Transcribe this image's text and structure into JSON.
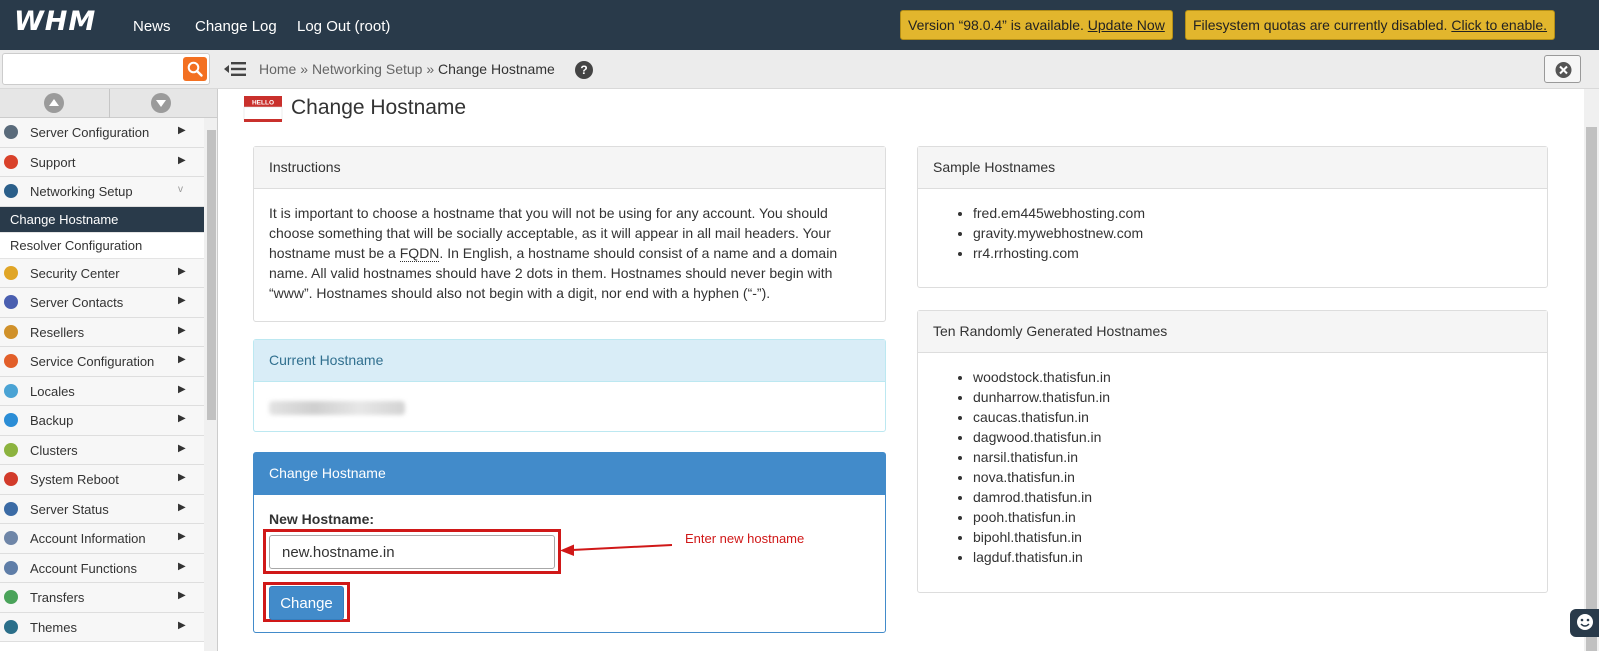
{
  "app": {
    "logo": "WHM"
  },
  "topnav": {
    "news": "News",
    "changelog": "Change Log",
    "logout": "Log Out (root)"
  },
  "notices": {
    "version": {
      "text": "Version “98.0.4” is available. ",
      "link": "Update Now"
    },
    "quota": {
      "text": "Filesystem quotas are currently disabled. ",
      "link": "Click to enable."
    }
  },
  "search": {
    "value": ""
  },
  "breadcrumb": {
    "home": "Home",
    "section": "Networking Setup",
    "current": "Change Hostname",
    "sep": "»"
  },
  "sidebar": {
    "items_before": [
      {
        "label": "Server Configuration",
        "arrow": "▶",
        "icon_color": "#5a6b7b"
      },
      {
        "label": "Support",
        "arrow": "▶",
        "icon_color": "#d9422b"
      },
      {
        "label": "Networking Setup",
        "arrow": "v",
        "icon_color": "#2b5f8a"
      }
    ],
    "sub_items": [
      {
        "label": "Change Hostname"
      },
      {
        "label": "Resolver Configuration"
      }
    ],
    "items_after": [
      {
        "label": "Security Center",
        "arrow": "▶",
        "icon_color": "#e0a526"
      },
      {
        "label": "Server Contacts",
        "arrow": "▶",
        "icon_color": "#4a5fb0"
      },
      {
        "label": "Resellers",
        "arrow": "▶",
        "icon_color": "#d0912a"
      },
      {
        "label": "Service Configuration",
        "arrow": "▶",
        "icon_color": "#e25f2a"
      },
      {
        "label": "Locales",
        "arrow": "▶",
        "icon_color": "#4aa3d4"
      },
      {
        "label": "Backup",
        "arrow": "▶",
        "icon_color": "#2b8dd6"
      },
      {
        "label": "Clusters",
        "arrow": "▶",
        "icon_color": "#8cb33f"
      },
      {
        "label": "System Reboot",
        "arrow": "▶",
        "icon_color": "#d23b2b"
      },
      {
        "label": "Server Status",
        "arrow": "▶",
        "icon_color": "#3b6ba5"
      },
      {
        "label": "Account Information",
        "arrow": "▶",
        "icon_color": "#6f86a8"
      },
      {
        "label": "Account Functions",
        "arrow": "▶",
        "icon_color": "#5f7ea8"
      },
      {
        "label": "Transfers",
        "arrow": "▶",
        "icon_color": "#4aa35a"
      },
      {
        "label": "Themes",
        "arrow": "▶",
        "icon_color": "#2b6f8a"
      }
    ]
  },
  "page": {
    "title": "Change Hostname",
    "icon_text": "HELLO"
  },
  "instructions": {
    "heading": "Instructions",
    "text_before": "It is important to choose a hostname that you will not be using for any account. You should choose something that will be socially acceptable, as it will appear in all mail headers. Your hostname must be a ",
    "abbr": "FQDN",
    "text_after": ". In English, a hostname should consist of a name and a domain name. All valid hostnames should have 2 dots in them. Hostnames should never begin with “www”. Hostnames should also not begin with a digit, nor end with a hyphen (“-”)."
  },
  "current": {
    "heading": "Current Hostname"
  },
  "change_form": {
    "heading": "Change Hostname",
    "field_label": "New Hostname:",
    "field_value": "new.hostname.in",
    "button_label": "Change",
    "annotation": "Enter new hostname"
  },
  "samples": {
    "heading": "Sample Hostnames",
    "items": [
      "fred.em445webhosting.com",
      "gravity.mywebhostnew.com",
      "rr4.rrhosting.com"
    ]
  },
  "random": {
    "heading": "Ten Randomly Generated Hostnames",
    "items": [
      "woodstock.thatisfun.in",
      "dunharrow.thatisfun.in",
      "caucas.thatisfun.in",
      "dagwood.thatisfun.in",
      "narsil.thatisfun.in",
      "nova.thatisfun.in",
      "damrod.thatisfun.in",
      "pooh.thatisfun.in",
      "bipohl.thatisfun.in",
      "lagduf.thatisfun.in"
    ]
  },
  "colors": {
    "topbar": "#293a4a",
    "accent": "#428bca",
    "notice": "#e2b62d",
    "highlight": "#d01818",
    "search": "#f37021"
  }
}
